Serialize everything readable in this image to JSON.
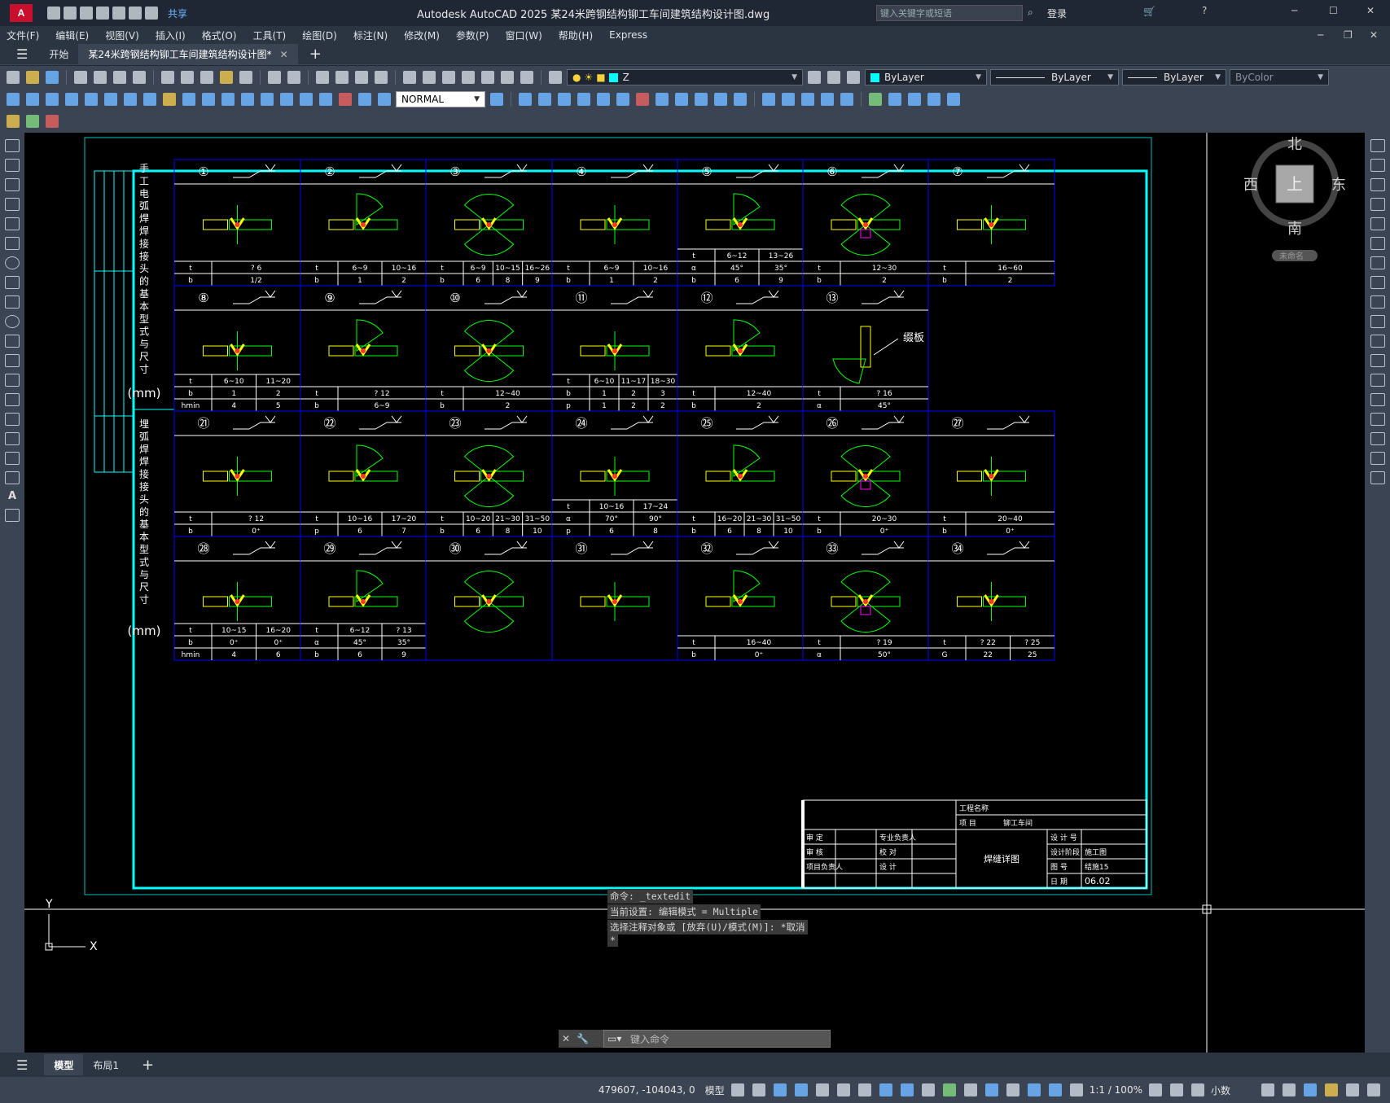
{
  "app": {
    "title": "Autodesk AutoCAD 2025    某24米跨钢结构铆工车间建筑结构设计图.dwg",
    "share_label": "共享",
    "search_placeholder": "键入关键字或短语",
    "login_label": "登录"
  },
  "menu": [
    "文件(F)",
    "编辑(E)",
    "视图(V)",
    "插入(I)",
    "格式(O)",
    "工具(T)",
    "绘图(D)",
    "标注(N)",
    "修改(M)",
    "参数(P)",
    "窗口(W)",
    "帮助(H)",
    "Express"
  ],
  "tabs": {
    "start": "开始",
    "doc": "某24米跨钢结构铆工车间建筑结构设计图*"
  },
  "toolbar": {
    "layer": "Z",
    "color": "ByLayer",
    "linetype": "ByLayer",
    "lineweight": "ByLayer",
    "plotstyle": "ByColor",
    "dimstyle": "NORMAL"
  },
  "viewcube": {
    "north": "北",
    "south": "南",
    "east": "东",
    "west": "西",
    "top": "上",
    "ucs": "未命名"
  },
  "drawing": {
    "section1_label": "手工电弧焊焊接接头的基本型式与尺寸",
    "section2_label": "埋弧焊焊接接头的基本型式与尺寸",
    "unit": "(mm)",
    "panels_row1": [
      {
        "num": "①",
        "rows": [
          [
            "t",
            "? 6"
          ],
          [
            "b",
            "1/2"
          ]
        ]
      },
      {
        "num": "②",
        "rows": [
          [
            "t",
            "6~9",
            "10~16"
          ],
          [
            "b",
            "1",
            "2"
          ]
        ]
      },
      {
        "num": "③",
        "rows": [
          [
            "t",
            "6~9",
            "10~15",
            "16~26"
          ],
          [
            "b",
            "6",
            "8",
            "9"
          ]
        ]
      },
      {
        "num": "④",
        "rows": [
          [
            "t",
            "6~9",
            "10~16"
          ],
          [
            "b",
            "1",
            "2"
          ]
        ]
      },
      {
        "num": "⑤",
        "rows": [
          [
            "t",
            "6~12",
            "13~26"
          ],
          [
            "α",
            "45°",
            "35°"
          ],
          [
            "b",
            "6",
            "9"
          ]
        ]
      },
      {
        "num": "⑥",
        "rows": [
          [
            "t",
            "12~30"
          ],
          [
            "b",
            "2"
          ]
        ]
      },
      {
        "num": "⑦",
        "rows": [
          [
            "t",
            "16~60"
          ],
          [
            "b",
            "2"
          ]
        ]
      }
    ],
    "panels_row2": [
      {
        "num": "⑧",
        "rows": [
          [
            "t",
            "6~10",
            "11~20"
          ],
          [
            "b",
            "1",
            "2"
          ],
          [
            "hmin",
            "4",
            "5"
          ]
        ]
      },
      {
        "num": "⑨",
        "rows": [
          [
            "t",
            "? 12"
          ],
          [
            "b",
            "6~9"
          ]
        ]
      },
      {
        "num": "⑩",
        "rows": [
          [
            "t",
            "12~40"
          ],
          [
            "b",
            "2"
          ]
        ]
      },
      {
        "num": "⑪",
        "rows": [
          [
            "t",
            "6~10",
            "11~17",
            "18~30"
          ],
          [
            "b",
            "1",
            "2",
            "3"
          ],
          [
            "p",
            "1",
            "2",
            "2"
          ]
        ]
      },
      {
        "num": "⑫",
        "rows": [
          [
            "t",
            "12~40"
          ],
          [
            "b",
            "2"
          ]
        ]
      },
      {
        "num": "⑬",
        "rows": [
          [
            "t",
            "? 16"
          ],
          [
            "α",
            "45°"
          ]
        ]
      }
    ],
    "panels_row3": [
      {
        "num": "㉑",
        "rows": [
          [
            "t",
            "? 12"
          ],
          [
            "b",
            "0⁺"
          ]
        ]
      },
      {
        "num": "㉒",
        "rows": [
          [
            "t",
            "10~16",
            "17~20"
          ],
          [
            "p",
            "6",
            "7"
          ]
        ]
      },
      {
        "num": "㉓",
        "rows": [
          [
            "t",
            "10~20",
            "21~30",
            "31~50"
          ],
          [
            "b",
            "6",
            "8",
            "10"
          ]
        ]
      },
      {
        "num": "㉔",
        "rows": [
          [
            "t",
            "10~16",
            "17~24"
          ],
          [
            "α",
            "70°",
            "90°"
          ],
          [
            "p",
            "6",
            "8"
          ]
        ]
      },
      {
        "num": "㉕",
        "rows": [
          [
            "t",
            "16~20",
            "21~30",
            "31~50"
          ],
          [
            "b",
            "6",
            "8",
            "10"
          ]
        ]
      },
      {
        "num": "㉖",
        "rows": [
          [
            "t",
            "20~30"
          ],
          [
            "b",
            "0⁺"
          ]
        ]
      },
      {
        "num": "㉗",
        "rows": [
          [
            "t",
            "20~40"
          ],
          [
            "b",
            "0⁺"
          ]
        ]
      }
    ],
    "panels_row4": [
      {
        "num": "㉘",
        "rows": [
          [
            "t",
            "10~15",
            "16~20"
          ],
          [
            "b",
            "0⁺",
            "0⁺"
          ],
          [
            "hmin",
            "4",
            "6"
          ]
        ]
      },
      {
        "num": "㉙",
        "rows": [
          [
            "t",
            "6~12",
            "? 13"
          ],
          [
            "α",
            "45°",
            "35°"
          ],
          [
            "b",
            "6",
            "9"
          ]
        ]
      },
      {
        "num": "㉚",
        "rows": []
      },
      {
        "num": "㉛",
        "rows": []
      },
      {
        "num": "㉜",
        "rows": [
          [
            "t",
            "16~40"
          ],
          [
            "b",
            "0⁺"
          ]
        ]
      },
      {
        "num": "㉝",
        "rows": [
          [
            "t",
            "? 19"
          ],
          [
            "α",
            "50°"
          ]
        ]
      },
      {
        "num": "㉞",
        "rows": [
          [
            "t",
            "? 22",
            "? 25"
          ],
          [
            "G",
            "22",
            "25"
          ]
        ]
      }
    ],
    "plate_label": "缀板",
    "titleblock": {
      "project_name": "工程名称",
      "item": "项    目",
      "item_value": "铆工车间",
      "approve": "审    定",
      "review": "审    核",
      "project_lead": "项目负责人",
      "discipline_lead": "专业负责人",
      "check": "校    对",
      "design": "设    计",
      "drawing_title": "焊缝详图",
      "design_no": "设 计 号",
      "design_stage": "设计阶段",
      "design_stage_value": "施工图",
      "drawing_no": "图    号",
      "drawing_no_value": "结施15",
      "date": "日    期",
      "date_value": "06.02"
    }
  },
  "command": {
    "line1": "命令: _textedit",
    "line2": "当前设置: 编辑模式 = Multiple",
    "line3": "选择注释对象或 [放弃(U)/模式(M)]: *取消",
    "line4": "*",
    "placeholder": "键入命令"
  },
  "layout_tabs": [
    "模型",
    "布局1"
  ],
  "status": {
    "coords": "479607, -104043, 0",
    "model": "模型",
    "scale": "1:1 / 100%",
    "units": "小数"
  }
}
